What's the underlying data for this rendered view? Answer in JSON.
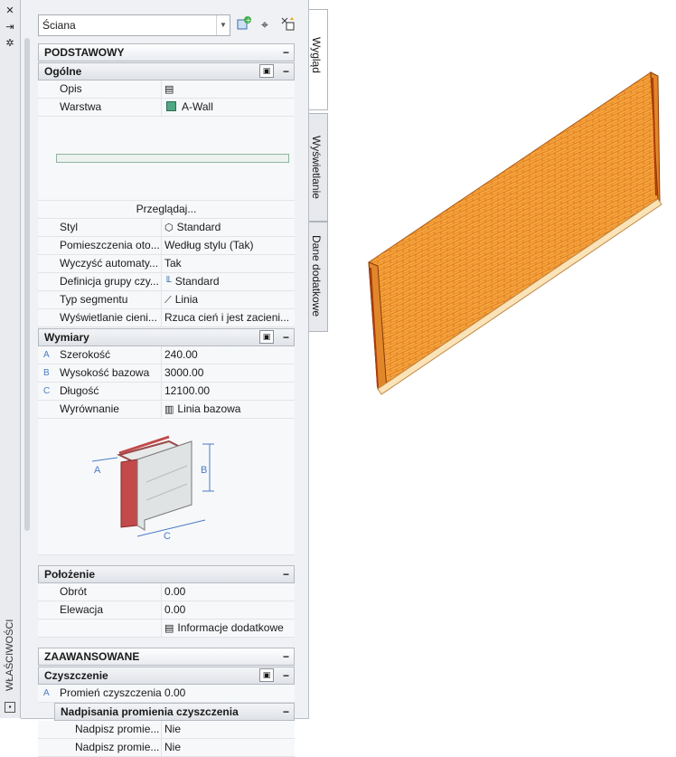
{
  "palette": {
    "title": "WŁAŚCIWOŚCI"
  },
  "selector": {
    "value": "Ściana"
  },
  "tabs": [
    "Wygląd",
    "Wyświetlanie",
    "Dane dodatkowe"
  ],
  "sections": {
    "podstawowy": "PODSTAWOWY",
    "ogolne": "Ogólne",
    "wymiary": "Wymiary",
    "polozenie": "Położenie",
    "zaawansowane": "ZAAWANSOWANE",
    "czyszczenie": "Czyszczenie",
    "nadpisania": "Nadpisania promienia czyszczenia"
  },
  "ogolne": {
    "opis": {
      "label": "Opis",
      "value": ""
    },
    "warstwa": {
      "label": "Warstwa",
      "value": "A-Wall"
    },
    "browse": "Przeglądaj...",
    "styl": {
      "label": "Styl",
      "value": "Standard"
    },
    "pomieszczenia": {
      "label": "Pomieszczenia oto...",
      "value": "Według stylu (Tak)"
    },
    "wyczysc": {
      "label": "Wyczyść automaty...",
      "value": "Tak"
    },
    "definicja": {
      "label": "Definicja grupy czy...",
      "value": "Standard"
    },
    "typ": {
      "label": "Typ segmentu",
      "value": "Linia"
    },
    "wyswietlanie": {
      "label": "Wyświetlanie cieni...",
      "value": "Rzuca cień i jest zacieni..."
    }
  },
  "wymiary": {
    "szerokosc": {
      "letter": "A",
      "label": "Szerokość",
      "value": "240.00"
    },
    "wysokosc": {
      "letter": "B",
      "label": "Wysokość bazowa",
      "value": "3000.00"
    },
    "dlugosc": {
      "letter": "C",
      "label": "Długość",
      "value": "12100.00"
    },
    "wyrownanie": {
      "label": "Wyrównanie",
      "value": "Linia bazowa"
    },
    "diagram_letters": [
      "A",
      "B",
      "C"
    ]
  },
  "polozenie": {
    "obrot": {
      "label": "Obrót",
      "value": "0.00"
    },
    "elewacja": {
      "label": "Elewacja",
      "value": "0.00"
    },
    "info": "Informacje dodatkowe"
  },
  "czyszczenie": {
    "promien": {
      "letter": "A",
      "label": "Promień czyszczenia",
      "value": "0.00"
    },
    "nadpisz1": {
      "label": "Nadpisz promie...",
      "value": "Nie"
    },
    "nadpisz2": {
      "label": "Nadpisz promie...",
      "value": "Nie"
    }
  }
}
